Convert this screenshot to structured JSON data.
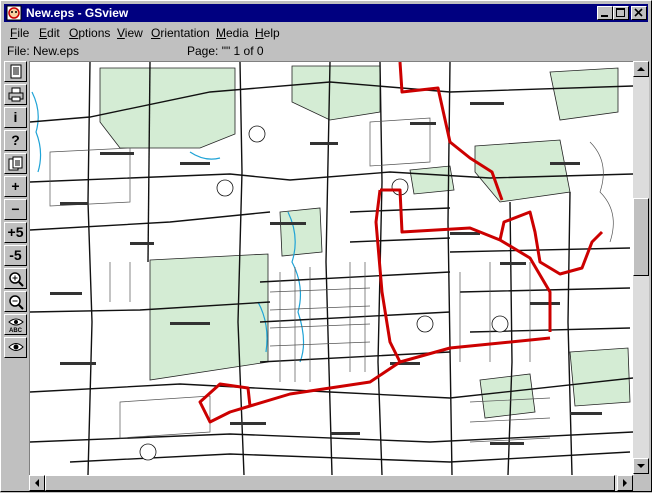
{
  "window": {
    "title": "New.eps - GSview"
  },
  "menu": [
    {
      "label": "File",
      "accel": "F",
      "rest": "ile"
    },
    {
      "label": "Edit",
      "accel": "E",
      "rest": "dit"
    },
    {
      "label": "Options",
      "accel": "O",
      "rest": "ptions"
    },
    {
      "label": "View",
      "accel": "V",
      "rest": "iew"
    },
    {
      "label": "Orientation",
      "accel": "O",
      "rest": "rientation"
    },
    {
      "label": "Media",
      "accel": "M",
      "rest": "edia"
    },
    {
      "label": "Help",
      "accel": "H",
      "rest": "elp"
    }
  ],
  "status": {
    "file": "File: New.eps",
    "page": "Page: \"\" 1 of 0"
  },
  "toolbar": [
    {
      "name": "open-file-button",
      "icon": "document-icon",
      "glyph": ""
    },
    {
      "name": "print-button",
      "icon": "printer-icon",
      "glyph": ""
    },
    {
      "name": "info-button",
      "icon": "info-icon",
      "glyph": "i"
    },
    {
      "name": "help-button",
      "icon": "question-icon",
      "glyph": "?"
    },
    {
      "name": "goto-page-button",
      "icon": "pages-icon",
      "glyph": ""
    },
    {
      "name": "next-page-button",
      "icon": "plus-icon",
      "glyph": "+"
    },
    {
      "name": "prev-page-button",
      "icon": "minus-icon",
      "glyph": "−"
    },
    {
      "name": "skip-forward-button",
      "icon": "plus5-icon",
      "glyph": "+5"
    },
    {
      "name": "skip-back-button",
      "icon": "minus5-icon",
      "glyph": "-5"
    },
    {
      "name": "zoom-in-button",
      "icon": "magnifier-plus-icon",
      "glyph": ""
    },
    {
      "name": "zoom-out-button",
      "icon": "magnifier-minus-icon",
      "glyph": ""
    },
    {
      "name": "eye-abc-button",
      "icon": "eye-abc-icon",
      "glyph": ""
    },
    {
      "name": "eye-button",
      "icon": "eye-icon",
      "glyph": ""
    }
  ],
  "colors": {
    "title_bg": "#000080",
    "park": "#d4ecd4",
    "water": "#1fa3d6",
    "route": "#cc0000"
  },
  "scroll": {
    "vertical_position": 0.37,
    "horizontal_position": 0.0
  }
}
